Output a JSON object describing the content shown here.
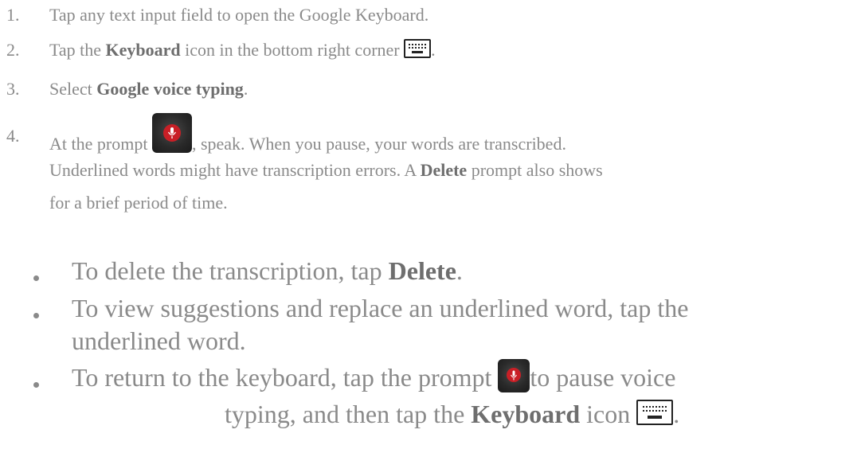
{
  "steps": [
    {
      "num": "1.",
      "text": "Tap any text input field to open the Google Keyboard."
    },
    {
      "num": "2.",
      "pre": "Tap the ",
      "bold": "Keyboard",
      "post": " icon in the bottom right corner ",
      "end": "."
    },
    {
      "num": "3.",
      "pre": "Select ",
      "bold": "Google voice typing",
      "post": "."
    },
    {
      "num": "4.",
      "pre": "At the prompt ",
      "post": ", speak. When you pause, your words are transcribed.",
      "line2_pre": "Underlined words might have transcription errors. A ",
      "line2_bold": "Delete",
      "line2_post": " prompt also shows",
      "line3": "for a brief period of time."
    }
  ],
  "bullets": [
    {
      "pre": "To delete the transcription, tap ",
      "bold": "Delete",
      "post": "."
    },
    {
      "line1": "To view suggestions and replace an underlined word, tap the",
      "line2": "underlined word."
    },
    {
      "pre": "To return to the keyboard, tap the prompt ",
      "post": "to pause voice",
      "line2_pre": "typing, and then tap the ",
      "line2_bold": "Keyboard",
      "line2_post": " icon ",
      "line2_end": "."
    }
  ],
  "icons": {
    "keyboard": "keyboard-icon",
    "mic": "microphone-prompt-icon"
  },
  "colors": {
    "text": "#8a8a8a",
    "bold": "#6e6e6e",
    "mic_red": "#c91f26",
    "mic_bg": "#2a2a2a"
  }
}
